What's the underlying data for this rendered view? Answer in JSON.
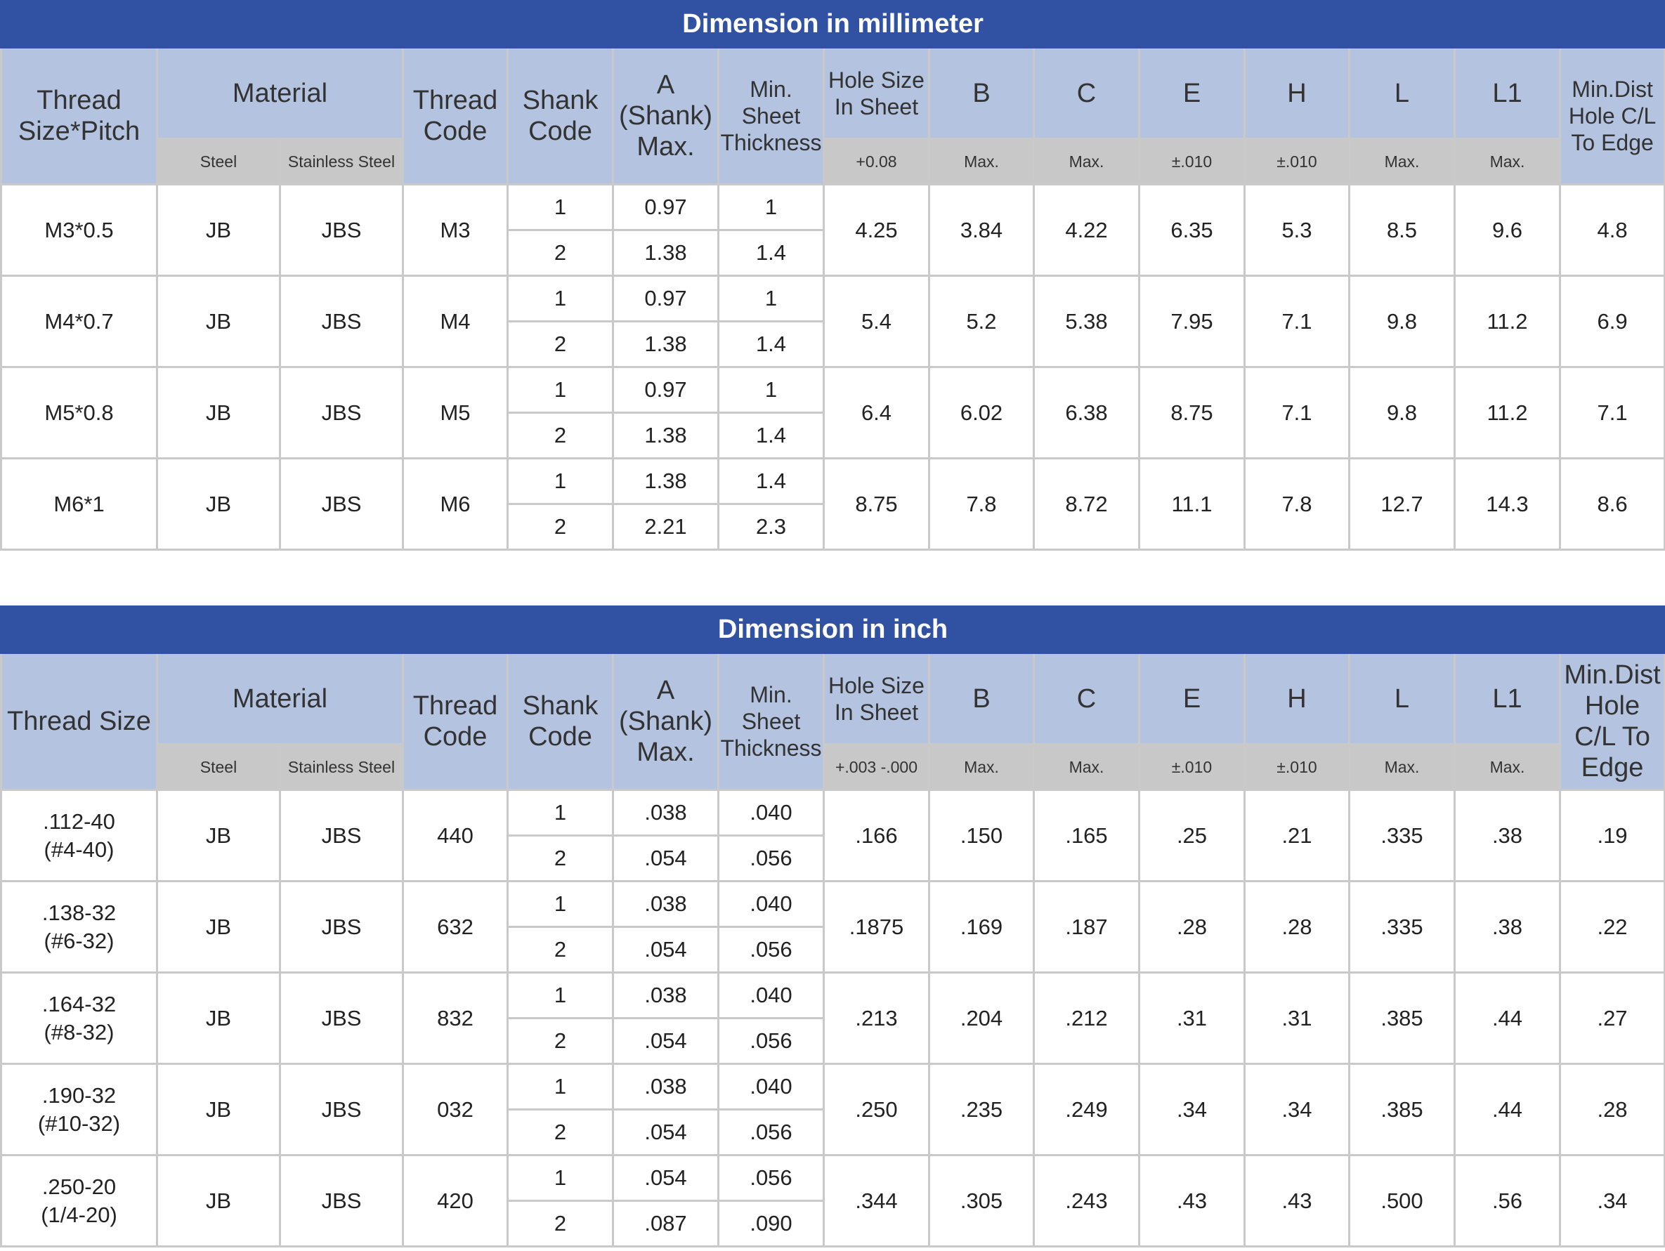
{
  "metric_table": {
    "title": "Dimension in millimeter",
    "headers": {
      "thread_size": "Thread Size*Pitch",
      "material": "Material",
      "thread_code": "Thread Code",
      "shank_code": "Shank Code",
      "a": "A (Shank) Max.",
      "min_sheet": "Min. Sheet Thickness",
      "hole_size": "Hole Size In Sheet",
      "b": "B",
      "c": "C",
      "e": "E",
      "h": "H",
      "l": "L",
      "l1": "L1",
      "min_dist": "Min.Dist Hole C/L To Edge"
    },
    "subheaders": {
      "steel": "Steel",
      "stainless": "Stainless Steel",
      "hole_tol": "+0.08",
      "b": "Max.",
      "c": "Max.",
      "e": "±.010",
      "h": "±.010",
      "l": "Max.",
      "l1": "Max."
    },
    "rows": [
      {
        "thread": "M3*0.5",
        "steel": "JB",
        "stainless": "JBS",
        "code": "M3",
        "shanks": [
          {
            "shank": "1",
            "a": "0.97",
            "min": "1"
          },
          {
            "shank": "2",
            "a": "1.38",
            "min": "1.4"
          }
        ],
        "hole": "4.25",
        "b": "3.84",
        "c": "4.22",
        "e": "6.35",
        "h": "5.3",
        "l": "8.5",
        "l1": "9.6",
        "dist": "4.8"
      },
      {
        "thread": "M4*0.7",
        "steel": "JB",
        "stainless": "JBS",
        "code": "M4",
        "shanks": [
          {
            "shank": "1",
            "a": "0.97",
            "min": "1"
          },
          {
            "shank": "2",
            "a": "1.38",
            "min": "1.4"
          }
        ],
        "hole": "5.4",
        "b": "5.2",
        "c": "5.38",
        "e": "7.95",
        "h": "7.1",
        "l": "9.8",
        "l1": "11.2",
        "dist": "6.9"
      },
      {
        "thread": "M5*0.8",
        "steel": "JB",
        "stainless": "JBS",
        "code": "M5",
        "shanks": [
          {
            "shank": "1",
            "a": "0.97",
            "min": "1"
          },
          {
            "shank": "2",
            "a": "1.38",
            "min": "1.4"
          }
        ],
        "hole": "6.4",
        "b": "6.02",
        "c": "6.38",
        "e": "8.75",
        "h": "7.1",
        "l": "9.8",
        "l1": "11.2",
        "dist": "7.1"
      },
      {
        "thread": "M6*1",
        "steel": "JB",
        "stainless": "JBS",
        "code": "M6",
        "shanks": [
          {
            "shank": "1",
            "a": "1.38",
            "min": "1.4"
          },
          {
            "shank": "2",
            "a": "2.21",
            "min": "2.3"
          }
        ],
        "hole": "8.75",
        "b": "7.8",
        "c": "8.72",
        "e": "11.1",
        "h": "7.8",
        "l": "12.7",
        "l1": "14.3",
        "dist": "8.6"
      }
    ]
  },
  "inch_table": {
    "title": "Dimension in inch",
    "headers": {
      "thread_size": "Thread Size",
      "material": "Material",
      "thread_code": "Thread Code",
      "shank_code": "Shank Code",
      "a": "A (Shank) Max.",
      "min_sheet": "Min. Sheet Thickness",
      "hole_size": "Hole Size In Sheet",
      "b": "B",
      "c": "C",
      "e": "E",
      "h": "H",
      "l": "L",
      "l1": "L1",
      "min_dist": "Min.Dist Hole C/L To Edge"
    },
    "subheaders": {
      "steel": "Steel",
      "stainless": "Stainless Steel",
      "hole_tol": "+.003 -.000",
      "b": "Max.",
      "c": "Max.",
      "e": "±.010",
      "h": "±.010",
      "l": "Max.",
      "l1": "Max."
    },
    "rows": [
      {
        "thread": ".112-40",
        "thread_alt": "(#4-40)",
        "steel": "JB",
        "stainless": "JBS",
        "code": "440",
        "shanks": [
          {
            "shank": "1",
            "a": ".038",
            "min": ".040"
          },
          {
            "shank": "2",
            "a": ".054",
            "min": ".056"
          }
        ],
        "hole": ".166",
        "b": ".150",
        "c": ".165",
        "e": ".25",
        "h": ".21",
        "l": ".335",
        "l1": ".38",
        "dist": ".19"
      },
      {
        "thread": ".138-32",
        "thread_alt": "(#6-32)",
        "steel": "JB",
        "stainless": "JBS",
        "code": "632",
        "shanks": [
          {
            "shank": "1",
            "a": ".038",
            "min": ".040"
          },
          {
            "shank": "2",
            "a": ".054",
            "min": ".056"
          }
        ],
        "hole": ".1875",
        "b": ".169",
        "c": ".187",
        "e": ".28",
        "h": ".28",
        "l": ".335",
        "l1": ".38",
        "dist": ".22"
      },
      {
        "thread": ".164-32",
        "thread_alt": "(#8-32)",
        "steel": "JB",
        "stainless": "JBS",
        "code": "832",
        "shanks": [
          {
            "shank": "1",
            "a": ".038",
            "min": ".040"
          },
          {
            "shank": "2",
            "a": ".054",
            "min": ".056"
          }
        ],
        "hole": ".213",
        "b": ".204",
        "c": ".212",
        "e": ".31",
        "h": ".31",
        "l": ".385",
        "l1": ".44",
        "dist": ".27"
      },
      {
        "thread": ".190-32",
        "thread_alt": "(#10-32)",
        "steel": "JB",
        "stainless": "JBS",
        "code": "032",
        "shanks": [
          {
            "shank": "1",
            "a": ".038",
            "min": ".040"
          },
          {
            "shank": "2",
            "a": ".054",
            "min": ".056"
          }
        ],
        "hole": ".250",
        "b": ".235",
        "c": ".249",
        "e": ".34",
        "h": ".34",
        "l": ".385",
        "l1": ".44",
        "dist": ".28"
      },
      {
        "thread": ".250-20",
        "thread_alt": "(1/4-20)",
        "steel": "JB",
        "stainless": "JBS",
        "code": "420",
        "shanks": [
          {
            "shank": "1",
            "a": ".054",
            "min": ".056"
          },
          {
            "shank": "2",
            "a": ".087",
            "min": ".090"
          }
        ],
        "hole": ".344",
        "b": ".305",
        "c": ".243",
        "e": ".43",
        "h": ".43",
        "l": ".500",
        "l1": ".56",
        "dist": ".34"
      }
    ]
  }
}
